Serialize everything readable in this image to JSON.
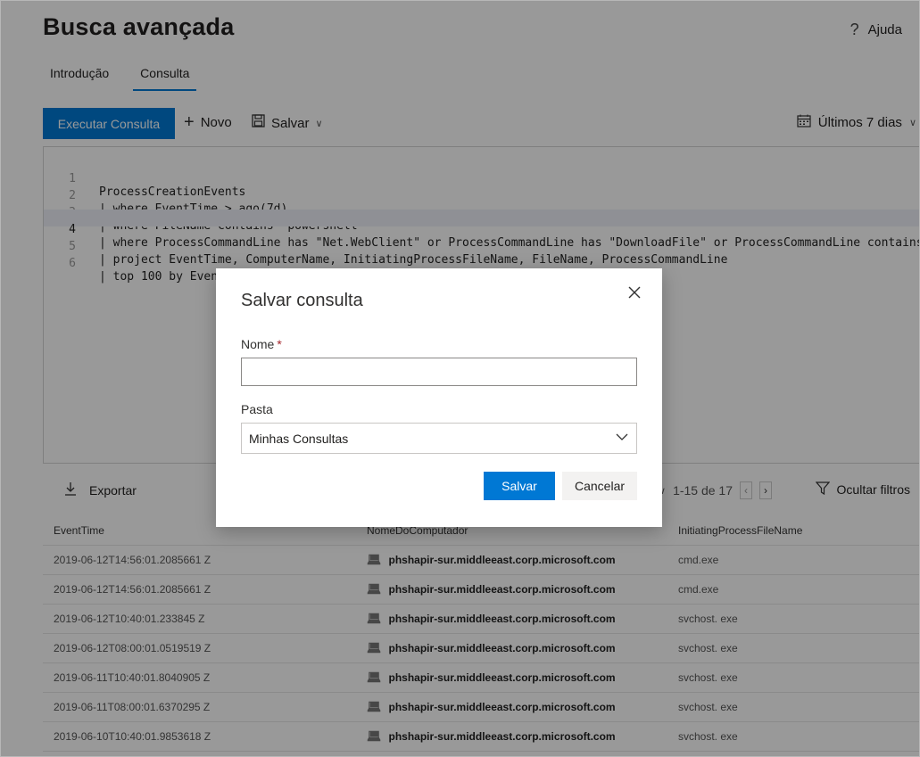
{
  "page": {
    "title": "Busca avançada",
    "help_label": "Ajuda"
  },
  "tabs": [
    {
      "label": "Introdução"
    },
    {
      "label": "Consulta"
    }
  ],
  "toolbar": {
    "run_label": "Executar Consulta",
    "new_label": "Novo",
    "save_label": "Salvar",
    "date_range": "Últimos 7 dias"
  },
  "editor": {
    "line_numbers": [
      "1",
      "2",
      "3",
      "4",
      "5",
      "6"
    ],
    "lines": [
      "ProcessCreationEvents",
      "| where EventTime > ago(7d)",
      "| where FileName contains \"powershell\"",
      "| where ProcessCommandLine has \"Net.WebClient\" or ProcessCommandLine has \"DownloadFile\" or ProcessCommandLine contains '",
      "| project EventTime, ComputerName, InitiatingProcessFileName, FileName, ProcessCommandLine",
      "| top 100 by EventTime"
    ]
  },
  "results": {
    "export_label": "Exportar",
    "pager": "1-15 de 17",
    "hide_filters_label": "Ocultar filtros"
  },
  "table": {
    "columns": [
      "EventTime",
      "NomeDoComputador",
      "InitiatingProcessFileName"
    ],
    "rows": [
      [
        "2019-06-12T14:56:01.2085661 Z",
        "phshapir-sur.middleeast.corp.microsoft.com",
        "cmd.exe"
      ],
      [
        "2019-06-12T14:56:01.2085661 Z",
        "phshapir-sur.middleeast.corp.microsoft.com",
        "cmd.exe"
      ],
      [
        "2019-06-12T10:40:01.233845 Z",
        "phshapir-sur.middleeast.corp.microsoft.com",
        "svchost. exe"
      ],
      [
        "2019-06-12T08:00:01.0519519 Z",
        "phshapir-sur.middleeast.corp.microsoft.com",
        "svchost. exe"
      ],
      [
        "2019-06-11T10:40:01.8040905 Z",
        "phshapir-sur.middleeast.corp.microsoft.com",
        "svchost. exe"
      ],
      [
        "2019-06-11T08:00:01.6370295 Z",
        "phshapir-sur.middleeast.corp.microsoft.com",
        "svchost. exe"
      ],
      [
        "2019-06-10T10:40:01.9853618 Z",
        "phshapir-sur.middleeast.corp.microsoft.com",
        "svchost. exe"
      ]
    ]
  },
  "dialog": {
    "title": "Salvar consulta",
    "name_label": "Nome",
    "required_mark": "*",
    "name_value": "",
    "folder_label": "Pasta",
    "folder_value": "Minhas Consultas",
    "save_label": "Salvar",
    "cancel_label": "Cancelar"
  },
  "colors": {
    "accent": "#0078d4",
    "overlay": "rgba(0,0,0,0.40)"
  }
}
